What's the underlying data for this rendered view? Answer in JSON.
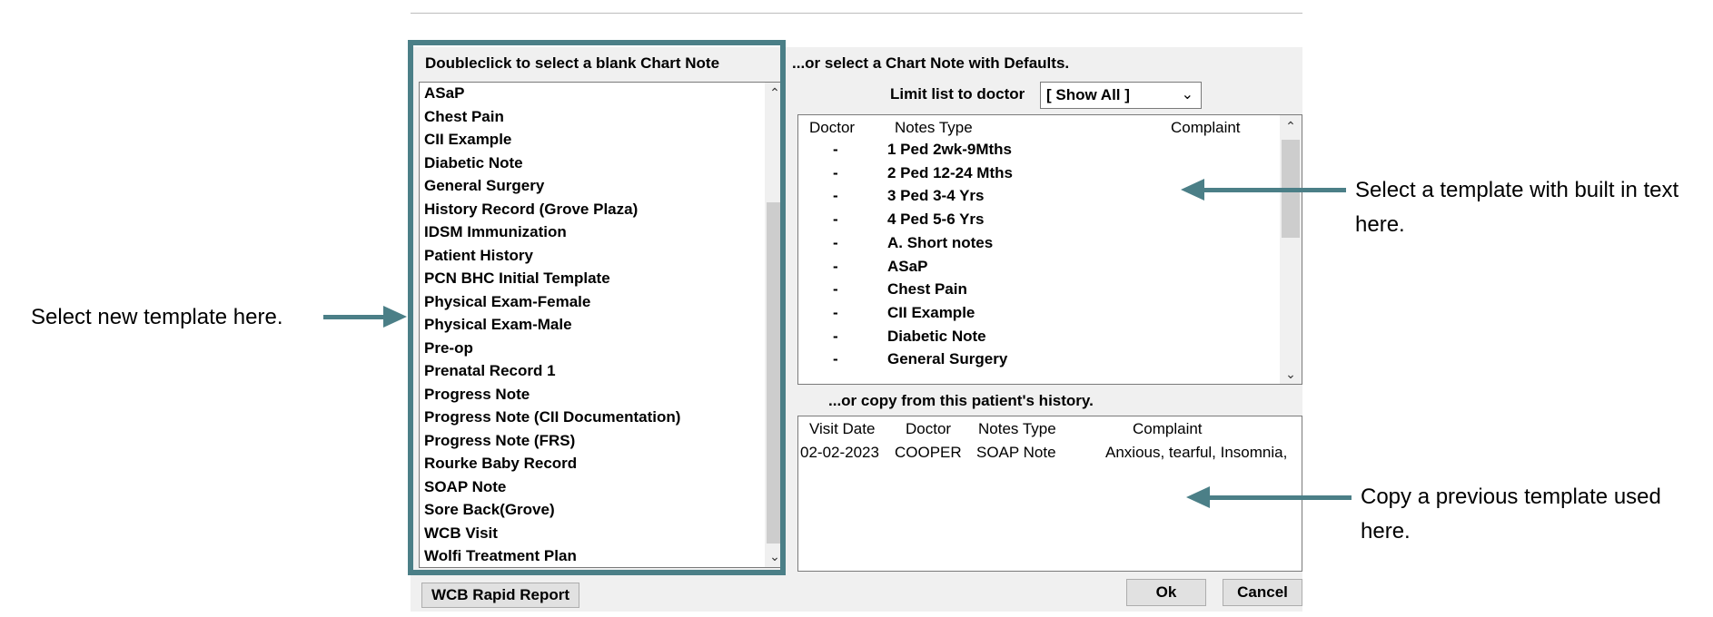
{
  "left_panel": {
    "heading": "Doubleclick to select a blank Chart Note",
    "items": [
      "ASaP",
      "Chest Pain",
      "CII Example",
      "Diabetic Note",
      "General Surgery",
      "History Record (Grove Plaza)",
      "IDSM Immunization",
      "Patient History",
      "PCN BHC Initial Template",
      "Physical Exam-Female",
      "Physical Exam-Male",
      "Pre-op",
      "Prenatal Record 1",
      "Progress Note",
      "Progress Note (CII Documentation)",
      "Progress Note (FRS)",
      "Rourke Baby Record",
      "SOAP Note",
      "Sore Back(Grove)",
      "WCB Visit",
      "Wolfi Treatment Plan"
    ],
    "rapid_report_button": "WCB Rapid Report"
  },
  "defaults_panel": {
    "heading": "...or select a Chart Note with Defaults.",
    "limit_label": "Limit list to doctor",
    "doctor_select_value": "[ Show All ]",
    "columns": [
      "Doctor",
      "Notes Type",
      "Complaint"
    ],
    "rows": [
      {
        "doctor": "-",
        "type": "1 Ped 2wk-9Mths"
      },
      {
        "doctor": "-",
        "type": "2 Ped 12-24 Mths"
      },
      {
        "doctor": "-",
        "type": "3 Ped 3-4 Yrs"
      },
      {
        "doctor": "-",
        "type": "4 Ped 5-6 Yrs"
      },
      {
        "doctor": "-",
        "type": "A. Short notes"
      },
      {
        "doctor": "-",
        "type": "ASaP"
      },
      {
        "doctor": "-",
        "type": "Chest Pain"
      },
      {
        "doctor": "-",
        "type": "CII Example"
      },
      {
        "doctor": "-",
        "type": "Diabetic Note"
      },
      {
        "doctor": "-",
        "type": "General Surgery"
      }
    ]
  },
  "history_panel": {
    "heading": "...or copy from this patient's history.",
    "columns": [
      "Visit Date",
      "Doctor",
      "Notes Type",
      "Complaint"
    ],
    "rows": [
      {
        "date": "02-02-2023",
        "doctor": "COOPER",
        "type": "SOAP Note",
        "complaint": "Anxious, tearful, Insomnia,"
      }
    ]
  },
  "buttons": {
    "ok": "Ok",
    "cancel": "Cancel"
  },
  "annotations": {
    "left": "Select new template here.",
    "right_top": "Select a template with built in text here.",
    "right_bottom": "Copy a previous template used here."
  },
  "colors": {
    "callout": "#4b7f87",
    "dialog_bg": "#f0f0f0"
  }
}
